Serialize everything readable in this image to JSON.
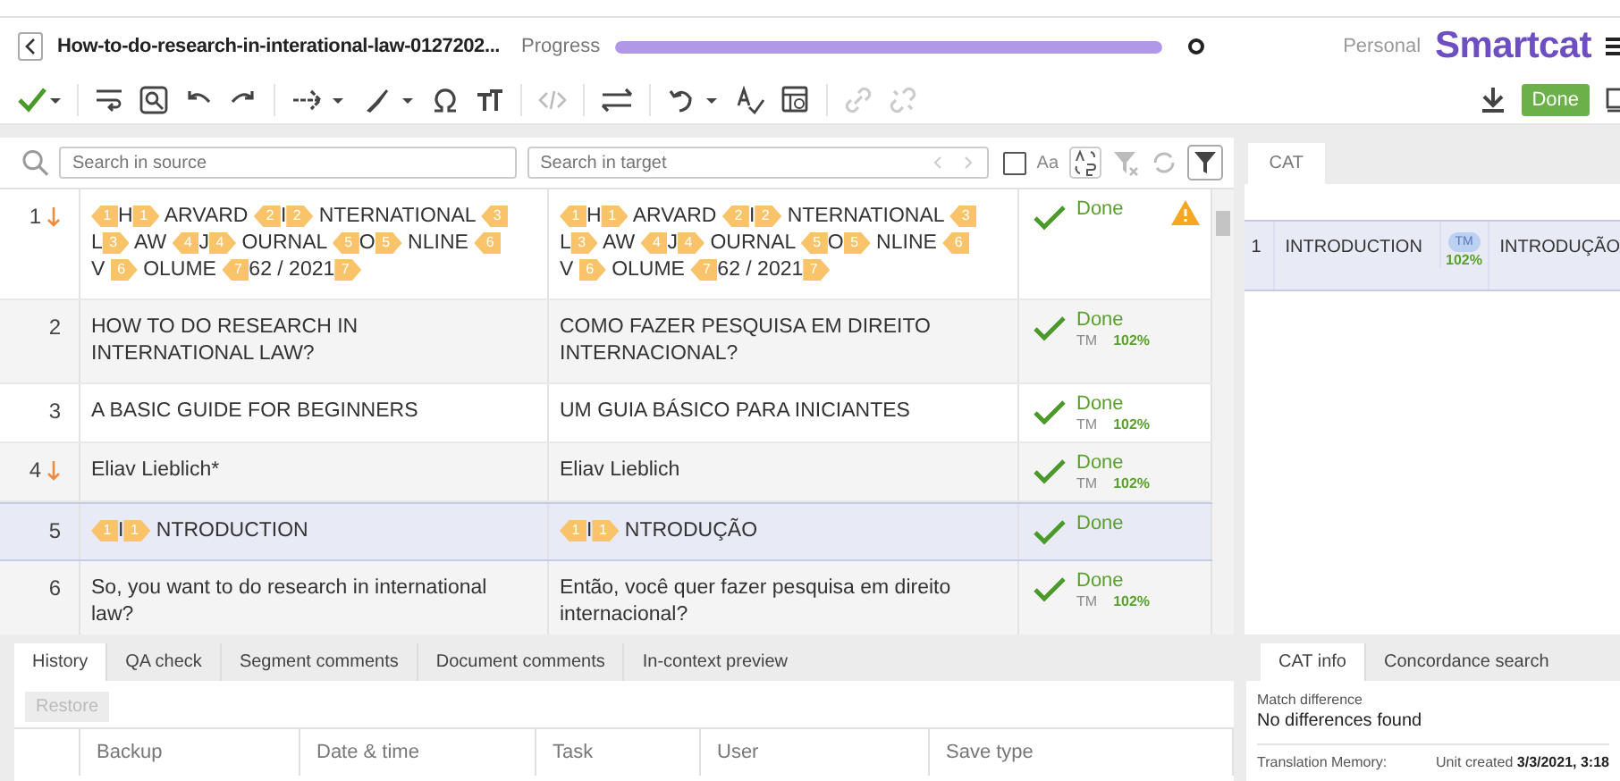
{
  "header": {
    "document_title": "How-to-do-research-in-interational-law-0127202...",
    "progress_label": "Progress",
    "progress": {
      "level": 1
    },
    "account": "Personal",
    "brand": "Smartcat"
  },
  "toolbar": {
    "done_button": "Done"
  },
  "search": {
    "source_placeholder": "Search in source",
    "target_placeholder": "Search in target",
    "case_checkbox": {
      "checked": false
    },
    "match_case": "Aa"
  },
  "segments": [
    {
      "number": "1",
      "changed": true,
      "selected": false,
      "warning": true,
      "status": "Done",
      "source": [
        {
          "kind": "open_tag",
          "text": "1"
        },
        {
          "kind": "text",
          "text": "H"
        },
        {
          "kind": "close_tag",
          "text": "1"
        },
        {
          "kind": "text",
          "text": " ARVARD "
        },
        {
          "kind": "open_tag",
          "text": "2"
        },
        {
          "kind": "text",
          "text": "I"
        },
        {
          "kind": "close_tag",
          "text": "2"
        },
        {
          "kind": "text",
          "text": " NTERNATIONAL "
        },
        {
          "kind": "open_tag",
          "text": "3"
        },
        {
          "kind": "text",
          "text": " L"
        },
        {
          "kind": "close_tag",
          "text": "3"
        },
        {
          "kind": "text",
          "text": " AW "
        },
        {
          "kind": "open_tag",
          "text": "4"
        },
        {
          "kind": "text",
          "text": "J"
        },
        {
          "kind": "close_tag",
          "text": "4"
        },
        {
          "kind": "text",
          "text": " OURNAL "
        },
        {
          "kind": "open_tag",
          "text": "5"
        },
        {
          "kind": "text",
          "text": "O"
        },
        {
          "kind": "close_tag",
          "text": "5"
        },
        {
          "kind": "text",
          "text": " NLINE "
        },
        {
          "kind": "open_tag",
          "text": "6"
        },
        {
          "kind": "text",
          "text": "V "
        },
        {
          "kind": "close_tag",
          "text": "6"
        },
        {
          "kind": "text",
          "text": " OLUME "
        },
        {
          "kind": "open_tag",
          "text": "7"
        },
        {
          "kind": "text",
          "text": "62 / 2021"
        },
        {
          "kind": "close_tag",
          "text": "7"
        }
      ],
      "target": [
        {
          "kind": "open_tag",
          "text": "1"
        },
        {
          "kind": "text",
          "text": "H"
        },
        {
          "kind": "close_tag",
          "text": "1"
        },
        {
          "kind": "text",
          "text": " ARVARD "
        },
        {
          "kind": "open_tag",
          "text": "2"
        },
        {
          "kind": "text",
          "text": "I"
        },
        {
          "kind": "close_tag",
          "text": "2"
        },
        {
          "kind": "text",
          "text": " NTERNATIONAL "
        },
        {
          "kind": "open_tag",
          "text": "3"
        },
        {
          "kind": "text",
          "text": " L"
        },
        {
          "kind": "close_tag",
          "text": "3"
        },
        {
          "kind": "text",
          "text": " AW "
        },
        {
          "kind": "open_tag",
          "text": "4"
        },
        {
          "kind": "text",
          "text": "J"
        },
        {
          "kind": "close_tag",
          "text": "4"
        },
        {
          "kind": "text",
          "text": " OURNAL "
        },
        {
          "kind": "open_tag",
          "text": "5"
        },
        {
          "kind": "text",
          "text": "O"
        },
        {
          "kind": "close_tag",
          "text": "5"
        },
        {
          "kind": "text",
          "text": " NLINE "
        },
        {
          "kind": "open_tag",
          "text": "6"
        },
        {
          "kind": "text",
          "text": "V "
        },
        {
          "kind": "close_tag",
          "text": "6"
        },
        {
          "kind": "text",
          "text": " OLUME "
        },
        {
          "kind": "open_tag",
          "text": "7"
        },
        {
          "kind": "text",
          "text": "62 / 2021"
        },
        {
          "kind": "close_tag",
          "text": "7"
        }
      ]
    },
    {
      "number": "2",
      "changed": false,
      "selected": false,
      "warning": false,
      "status": "Done",
      "match": {
        "origin": "TM",
        "percent": "102%"
      },
      "source": [
        {
          "kind": "text",
          "text": "HOW TO DO RESEARCH IN INTERNATIONAL LAW?"
        }
      ],
      "target": [
        {
          "kind": "text",
          "text": "COMO FAZER PESQUISA EM DIREITO INTERNACIONAL?"
        }
      ]
    },
    {
      "number": "3",
      "changed": false,
      "selected": false,
      "warning": false,
      "status": "Done",
      "match": {
        "origin": "TM",
        "percent": "102%"
      },
      "source": [
        {
          "kind": "text",
          "text": "A BASIC GUIDE FOR BEGINNERS"
        }
      ],
      "target": [
        {
          "kind": "text",
          "text": "UM GUIA BÁSICO PARA INICIANTES"
        }
      ]
    },
    {
      "number": "4",
      "changed": true,
      "selected": false,
      "warning": false,
      "status": "Done",
      "match": {
        "origin": "TM",
        "percent": "102%"
      },
      "source": [
        {
          "kind": "text",
          "text": "Eliav Lieblich*"
        }
      ],
      "target": [
        {
          "kind": "text",
          "text": "Eliav Lieblich"
        }
      ]
    },
    {
      "number": "5",
      "changed": false,
      "selected": true,
      "warning": false,
      "status": "Done",
      "source": [
        {
          "kind": "open_tag",
          "text": "1"
        },
        {
          "kind": "text",
          "text": "I"
        },
        {
          "kind": "close_tag",
          "text": "1"
        },
        {
          "kind": "text",
          "text": " NTRODUCTION"
        }
      ],
      "target": [
        {
          "kind": "open_tag",
          "text": "1"
        },
        {
          "kind": "text",
          "text": "I"
        },
        {
          "kind": "close_tag",
          "text": "1"
        },
        {
          "kind": "text",
          "text": " NTRODUÇÃO"
        }
      ]
    },
    {
      "number": "6",
      "changed": false,
      "selected": false,
      "warning": false,
      "status": "Done",
      "match": {
        "origin": "TM",
        "percent": "102%"
      },
      "source": [
        {
          "kind": "text",
          "text": "So, you want to do research in international law?"
        }
      ],
      "target": [
        {
          "kind": "text",
          "text": "Então, você quer fazer pesquisa em direito internacional?"
        }
      ]
    }
  ],
  "cat": {
    "tab": "CAT",
    "matches": [
      {
        "number": "1",
        "source": "INTRODUCTION",
        "origin": "TM",
        "percent": "102%",
        "target": "INTRODUÇÃO",
        "selected": true
      }
    ]
  },
  "bottom_tabs": [
    {
      "label": "History",
      "selected": true
    },
    {
      "label": "QA check",
      "selected": false
    },
    {
      "label": "Segment comments",
      "selected": false
    },
    {
      "label": "Document comments",
      "selected": false
    },
    {
      "label": "In-context preview",
      "selected": false
    }
  ],
  "restore_button": {
    "label": "Restore",
    "disabled": true
  },
  "history_columns": [
    "Backup",
    "Date & time",
    "Task",
    "User",
    "Save type"
  ],
  "info_tabs": [
    {
      "label": "CAT info",
      "selected": true
    },
    {
      "label": "Concordance search",
      "selected": false
    }
  ],
  "cat_info": {
    "match_difference_label": "Match difference",
    "match_difference": "No differences found",
    "tm_label": "Translation Memory:",
    "unit_created": "Unit created **3/3/2021, 3:18**"
  }
}
